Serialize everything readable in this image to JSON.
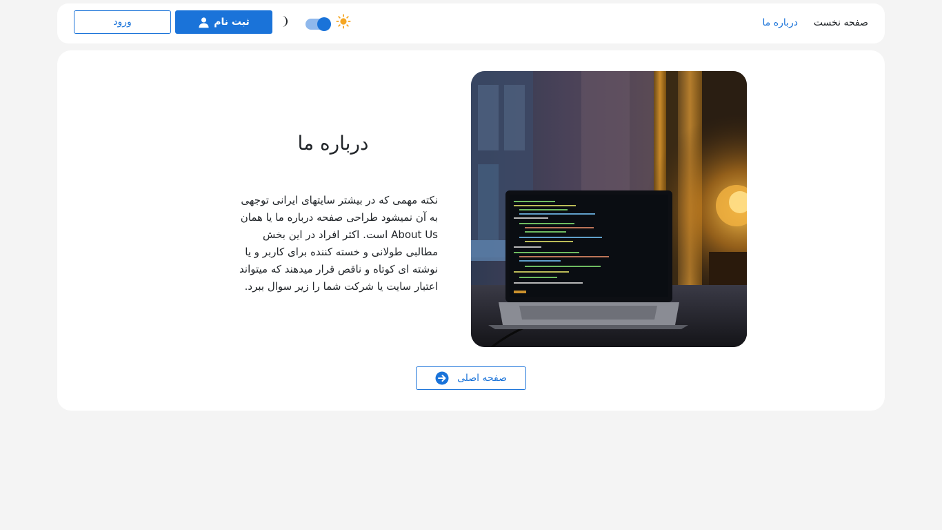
{
  "nav": {
    "home_label": "صفحه نخست",
    "about_label": "درباره ما",
    "theme_toggle_state": "light",
    "register_label": "ثبت نام",
    "login_label": "ورود"
  },
  "main": {
    "title": "درباره ما",
    "description": "نکته مهمی که در بیشتر سایتهای ایرانی توجهی به آن نمیشود طراحی صفحه درباره ما یا همان About Us است. اکثر افراد در این بخش مطالبی طولانی و خسته کننده برای کاربر و یا نوشته ای کوتاه و ناقص قرار میدهند که میتواند اعتبار سایت یا شرکت شما را زیر سوال ببرد.",
    "home_button_label": "صفحه اصلی"
  },
  "icons": {
    "sun": "sun-icon",
    "moon": "moon-icon",
    "user": "user-icon",
    "arrow": "arrow-right-circle-icon"
  },
  "colors": {
    "accent": "#1a73d9",
    "background": "#f4f4f4",
    "card": "#ffffff",
    "sun": "#f5a623"
  }
}
